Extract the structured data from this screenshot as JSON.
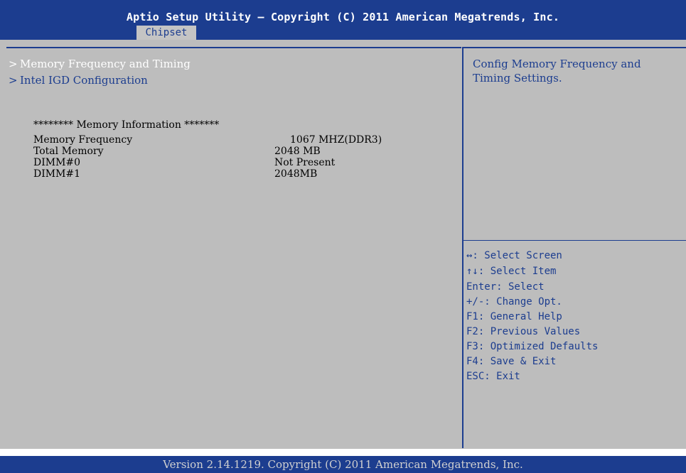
{
  "header": {
    "title": "Aptio Setup Utility – Copyright (C) 2011 American Megatrends, Inc.",
    "tabs": [
      {
        "label": "Chipset",
        "active": true
      }
    ]
  },
  "menu": {
    "chevron": ">",
    "items": [
      {
        "label": "Memory Frequency and Timing",
        "selected": true
      },
      {
        "label": "Intel IGD Configuration",
        "selected": false
      }
    ]
  },
  "memory_info": {
    "heading": "******** Memory Information *******",
    "rows": [
      {
        "label": "Memory Frequency",
        "value": "1067 MHZ(DDR3)"
      },
      {
        "label": "Total Memory",
        "value": "2048 MB"
      },
      {
        "label": "DIMM#0",
        "value": "Not Present"
      },
      {
        "label": "DIMM#1",
        "value": "2048MB"
      }
    ]
  },
  "help": {
    "line1": "Config Memory Frequency and",
    "line2": "Timing Settings."
  },
  "keys": [
    "↔: Select Screen",
    "↑↓: Select Item",
    "Enter: Select",
    "+/-: Change Opt.",
    "F1: General Help",
    "F2: Previous Values",
    "F3: Optimized Defaults",
    "F4: Save & Exit",
    "ESC: Exit"
  ],
  "footer": {
    "version": "Version 2.14.1219. Copyright (C) 2011 American Megatrends, Inc."
  },
  "colors": {
    "bar_blue": "#1c3d8f",
    "panel_grey": "#bdbdbd",
    "tab_grey": "#c4c4c4",
    "text_blue": "#1c3d8f",
    "selected_white": "#ffffff"
  }
}
